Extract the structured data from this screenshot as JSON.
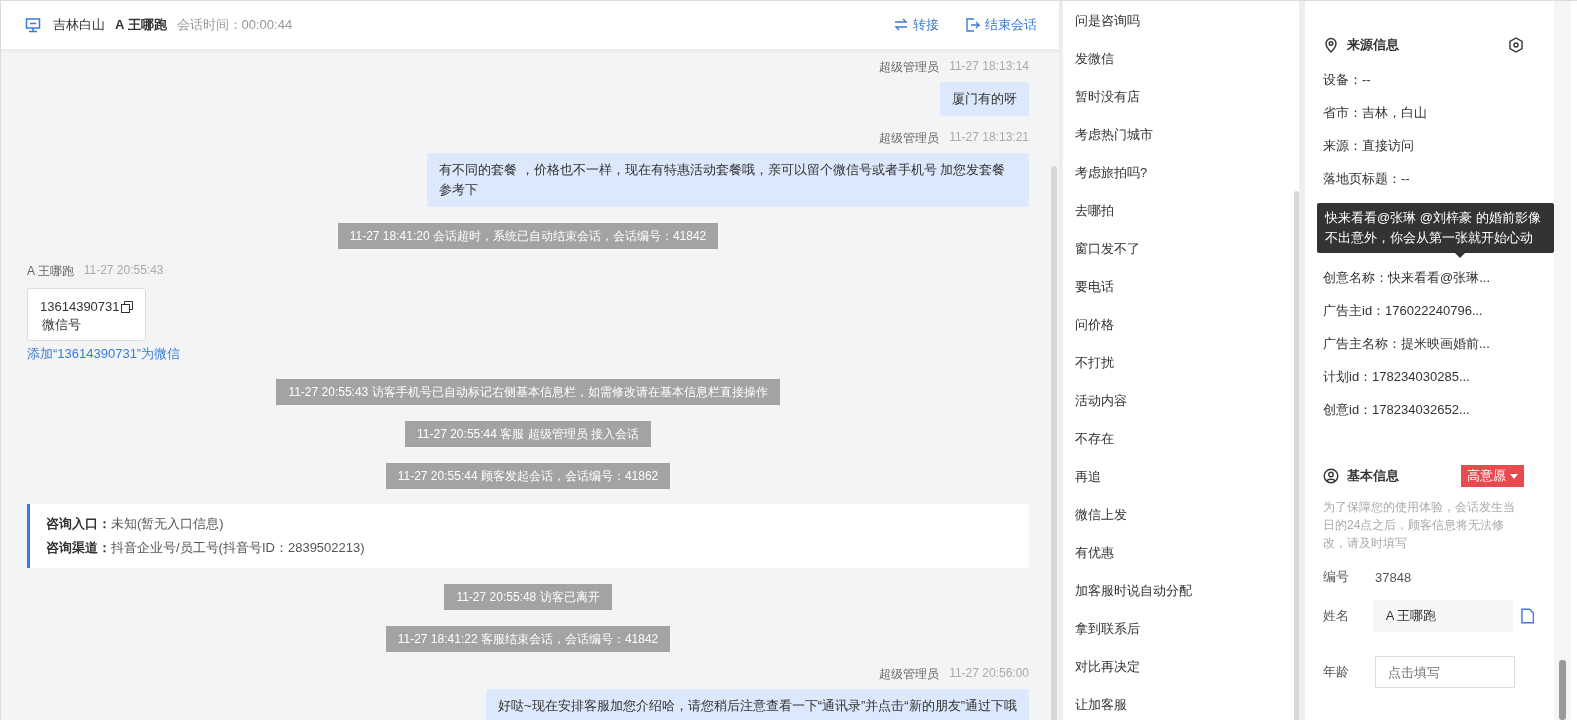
{
  "header": {
    "location": "吉林白山",
    "visitor": "A 王哪跑",
    "session_time": "会话时间：00:00:44",
    "actions": [
      {
        "kind": "transfer",
        "label": "转接"
      },
      {
        "kind": "end",
        "label": "结束会话"
      }
    ]
  },
  "messages": [
    {
      "kind": "agent",
      "sender": "超级管理员",
      "time": "11-27 18:13:14",
      "text": "厦门有的呀"
    },
    {
      "kind": "agent",
      "sender": "超级管理员",
      "time": "11-27 18:13:21",
      "text": "有不同的套餐 ，价格也不一样，现在有特惠活动套餐哦，亲可以留个微信号或者手机号 加您发套餐参考下"
    },
    {
      "kind": "system",
      "text": "11-27 18:41:20 会话超时，系统已自动结束会话，会话编号：41842"
    },
    {
      "kind": "visitor",
      "sender": "A 王哪跑",
      "time": "11-27 20:55:43",
      "number": "13614390731",
      "caption": "微信号",
      "link": "添加“13614390731”为微信"
    },
    {
      "kind": "system",
      "text": "11-27 20:55:43 访客手机号已自动标记右侧基本信息栏，如需修改请在基本信息栏直接操作"
    },
    {
      "kind": "system",
      "text": "11-27 20:55:44 客服 超级管理员 接入会话"
    },
    {
      "kind": "system",
      "text": "11-27 20:55:44 顾客发起会话，会话编号：41862"
    },
    {
      "kind": "info",
      "rows": [
        {
          "label": "咨询入口：",
          "value": "未知(暂无入口信息)"
        },
        {
          "label": "咨询渠道：",
          "value": "抖音企业号/员工号(抖音号ID：2839502213)"
        }
      ]
    },
    {
      "kind": "system",
      "text": "11-27 20:55:48 访客已离开"
    },
    {
      "kind": "system",
      "text": "11-27 18:41:22 客服结束会话，会话编号：41842"
    },
    {
      "kind": "agent",
      "sender": "超级管理员",
      "time": "11-27 20:56:00",
      "text": "好哒~现在安排客服加您介绍哈，请您稍后注意查看一下“通讯录”并点击“新的朋友”通过下哦"
    }
  ],
  "quick_replies": [
    "问是咨询吗",
    "发微信",
    "暂时没有店",
    "考虑热门城市",
    "考虑旅拍吗?",
    "去哪拍",
    "窗口发不了",
    "要电话",
    "问价格",
    "不打扰",
    "活动内容",
    "不存在",
    "再追",
    "微信上发",
    "有优惠",
    "加客服时说自动分配",
    "拿到联系后",
    "对比再决定",
    "让加客服"
  ],
  "source_info": {
    "title": "来源信息",
    "rows": [
      {
        "text": "设备：--"
      },
      {
        "text": "省市：吉林，白山"
      },
      {
        "text": "来源：直接访问"
      },
      {
        "text": "落地页标题：--"
      }
    ],
    "tooltip": [
      "快来看看@张琳 @刘梓豪 的婚前影像",
      "不出意外，你会从第一张就开始心动"
    ],
    "rows_below": [
      {
        "text": "创意名称：快来看看@张琳..."
      },
      {
        "text": "广告主id：176022240796..."
      },
      {
        "text": "广告主名称：提米映画婚前..."
      },
      {
        "text": "计划id：178234030285..."
      },
      {
        "text": "创意id：178234032652..."
      }
    ]
  },
  "basic_info": {
    "title": "基本信息",
    "intent": "高意愿",
    "note": "为了保障您的使用体验，会话发生当日的24点之后，顾客信息将无法修改，请及时填写",
    "id_label": "编号",
    "id_value": "37848",
    "fields": [
      {
        "label": "姓名",
        "value": "A 王哪跑"
      },
      {
        "label": "年龄",
        "placeholder": "点击填写"
      }
    ]
  }
}
